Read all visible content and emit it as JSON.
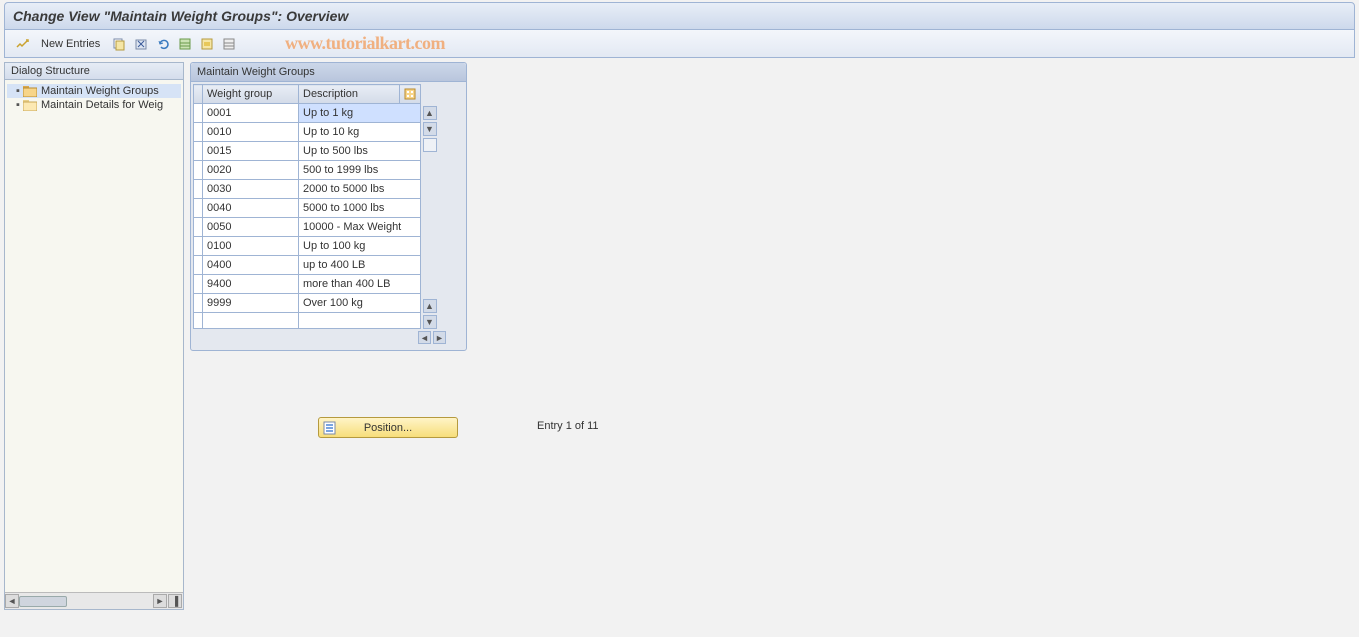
{
  "title": "Change View \"Maintain Weight Groups\": Overview",
  "toolbar": {
    "new_entries": "New Entries"
  },
  "watermark": "www.tutorialkart.com",
  "sidebar": {
    "heading": "Dialog Structure",
    "items": [
      {
        "label": "Maintain Weight Groups",
        "selected": true,
        "open": true
      },
      {
        "label": "Maintain Details for Weig",
        "selected": false,
        "open": false
      }
    ]
  },
  "grid": {
    "title": "Maintain Weight Groups",
    "col1": "Weight group",
    "col2": "Description",
    "rows": [
      {
        "wg": "0001",
        "desc": "Up to 1 kg",
        "selected": true
      },
      {
        "wg": "0010",
        "desc": "Up to 10 kg"
      },
      {
        "wg": "0015",
        "desc": "Up to 500 lbs"
      },
      {
        "wg": "0020",
        "desc": "500 to 1999 lbs"
      },
      {
        "wg": "0030",
        "desc": "2000 to 5000 lbs"
      },
      {
        "wg": "0040",
        "desc": "5000 to 1000 lbs"
      },
      {
        "wg": "0050",
        "desc": "10000 - Max Weight"
      },
      {
        "wg": "0100",
        "desc": "Up to 100 kg"
      },
      {
        "wg": "0400",
        "desc": "up to 400 LB"
      },
      {
        "wg": "9400",
        "desc": "more than 400 LB"
      },
      {
        "wg": "9999",
        "desc": "Over 100 kg"
      },
      {
        "wg": "",
        "desc": ""
      }
    ]
  },
  "position_button": "Position...",
  "status": "Entry 1 of 11"
}
